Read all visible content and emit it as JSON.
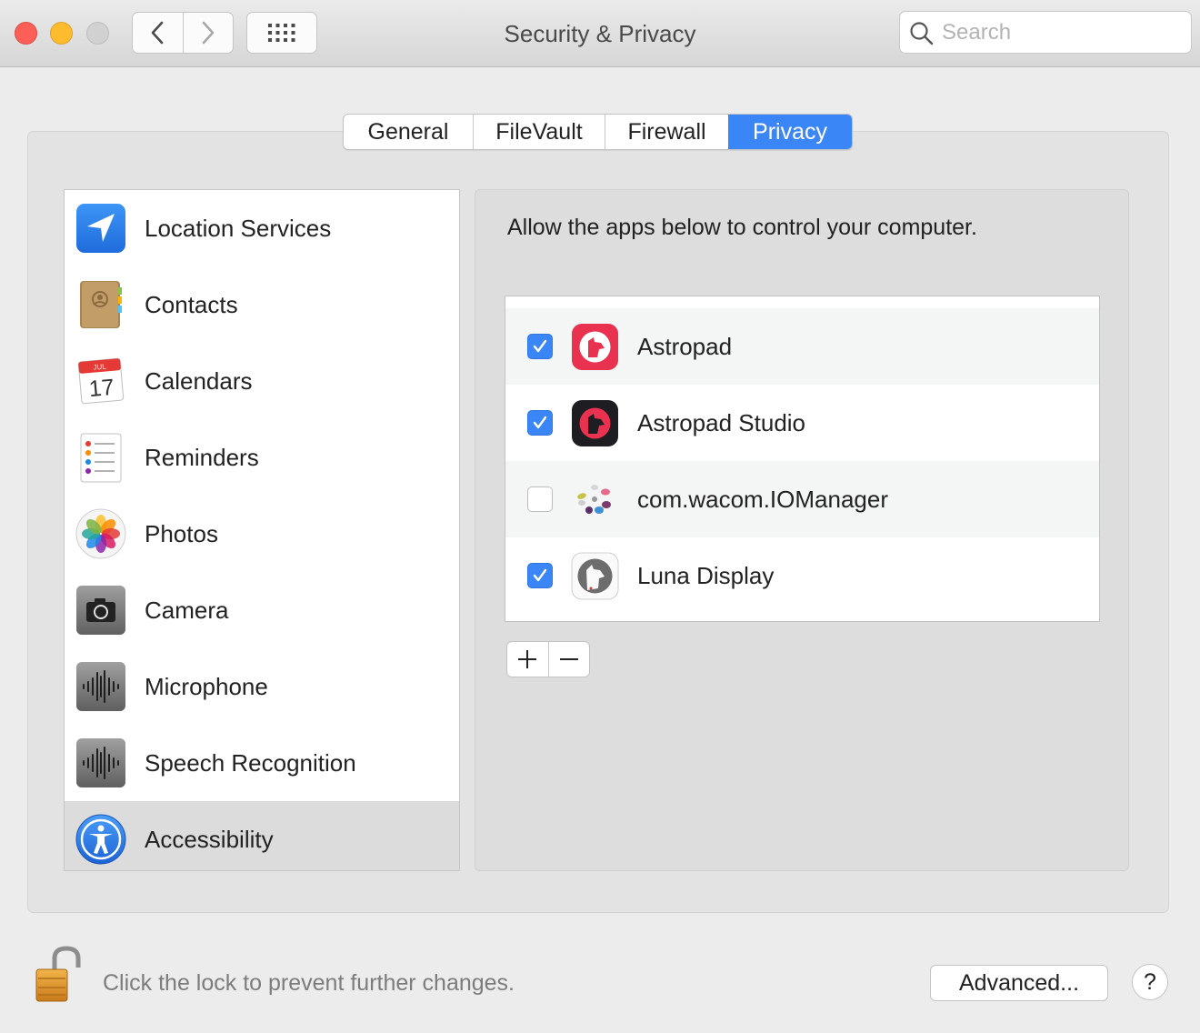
{
  "window": {
    "title": "Security & Privacy",
    "search_placeholder": "Search"
  },
  "tabs": [
    {
      "label": "General",
      "active": false
    },
    {
      "label": "FileVault",
      "active": false
    },
    {
      "label": "Firewall",
      "active": false
    },
    {
      "label": "Privacy",
      "active": true
    }
  ],
  "sidebar": {
    "items": [
      {
        "label": "Location Services",
        "icon": "location-arrow-icon",
        "selected": false
      },
      {
        "label": "Contacts",
        "icon": "contacts-book-icon",
        "selected": false
      },
      {
        "label": "Calendars",
        "icon": "calendar-icon",
        "month": "JUL",
        "day": "17",
        "selected": false
      },
      {
        "label": "Reminders",
        "icon": "reminders-list-icon",
        "selected": false
      },
      {
        "label": "Photos",
        "icon": "photos-flower-icon",
        "selected": false
      },
      {
        "label": "Camera",
        "icon": "camera-icon",
        "selected": false
      },
      {
        "label": "Microphone",
        "icon": "microphone-waveform-icon",
        "selected": false
      },
      {
        "label": "Speech Recognition",
        "icon": "speech-waveform-icon",
        "selected": false
      },
      {
        "label": "Accessibility",
        "icon": "accessibility-figure-icon",
        "selected": true
      }
    ]
  },
  "detail": {
    "description": "Allow the apps below to control your computer.",
    "apps": [
      {
        "name": "Astropad",
        "checked": true,
        "icon": "astropad-icon"
      },
      {
        "name": "Astropad Studio",
        "checked": true,
        "icon": "astropad-studio-icon"
      },
      {
        "name": "com.wacom.IOManager",
        "checked": false,
        "icon": "wacom-icon"
      },
      {
        "name": "Luna Display",
        "checked": true,
        "icon": "luna-display-icon"
      }
    ],
    "add_label": "+",
    "remove_label": "−"
  },
  "footer": {
    "lock_text": "Click the lock to prevent further changes.",
    "advanced_label": "Advanced...",
    "help_label": "?"
  },
  "colors": {
    "accent": "#3b86f7",
    "selected_row": "#dcdcdc"
  }
}
